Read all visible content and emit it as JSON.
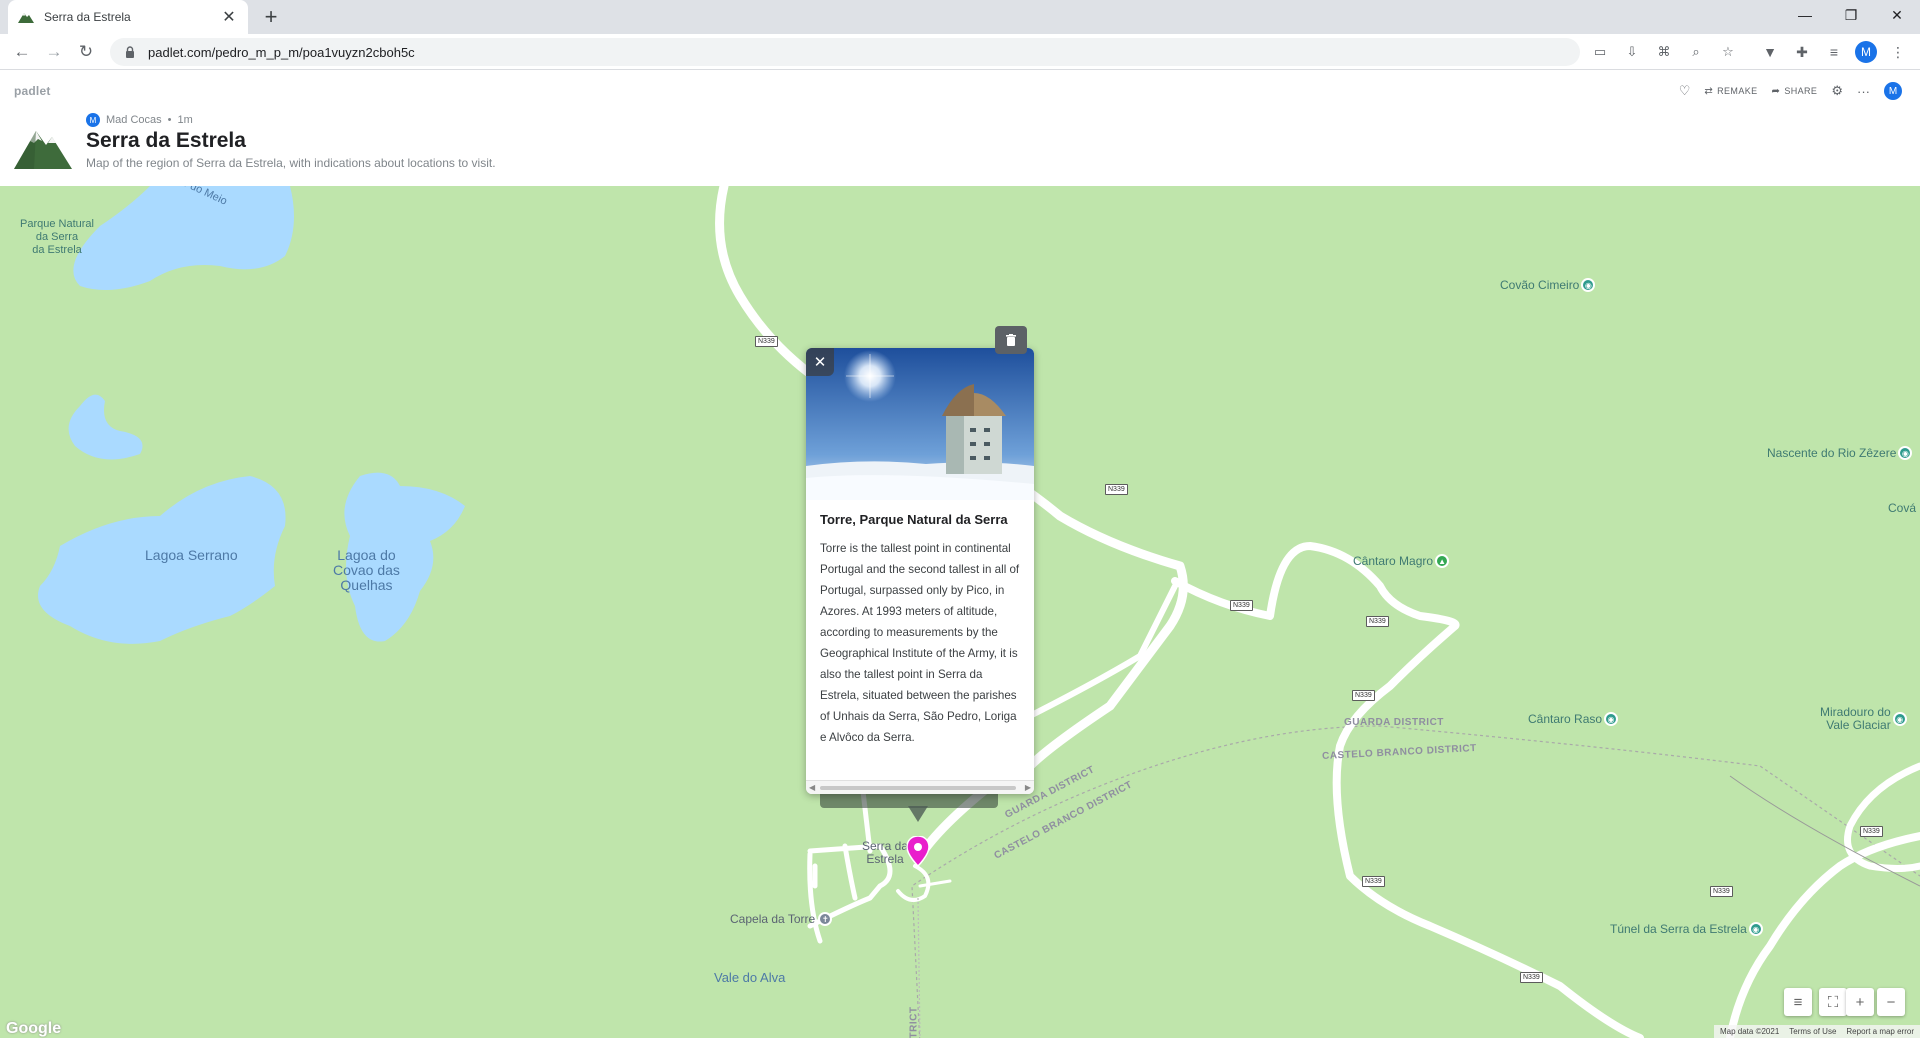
{
  "browser": {
    "tab_title": "Serra da Estrela",
    "url": "padlet.com/pedro_m_p_m/poa1vuyzn2cboh5c",
    "profile_initial": "M"
  },
  "padlet": {
    "brand": "padlet",
    "actions": {
      "remake": "REMAKE",
      "share": "SHARE"
    },
    "user_initial": "M",
    "author": "Mad Cocas",
    "age": "1m",
    "title": "Serra da Estrela",
    "description": "Map of the region of Serra da Estrela, with indications about locations to visit."
  },
  "map": {
    "labels": {
      "parque_natural": "Parque Natural\nda Serra\nda Estrela",
      "lagoa_serrano": "Lagoa Serrano",
      "lagoa_covao": "Lagoa do\nCovao das\nQuelhas",
      "meio_partial": "o do Meio",
      "covao_cimeiro": "Covão Cimeiro",
      "nascente": "Nascente do Rio Zêzere",
      "cova_partial": "Cová",
      "cantaro_magro": "Cântaro Magro",
      "cantaro_raso": "Cântaro Raso",
      "miradouro": "Miradouro do\nVale Glaciar",
      "guarda_district": "GUARDA DISTRICT",
      "castelo_branco_district": "CASTELO BRANCO DISTRICT",
      "serra_estrela": "Serra da\nEstrela",
      "capela_torre": "Capela da Torre",
      "vale_alva": "Vale do Alva",
      "tunel": "Túnel da Serra da Estrela",
      "trict_partial": "TRICT"
    },
    "road": "N339",
    "google": "Google",
    "attribution": [
      "Map data ©2021",
      "Terms of Use",
      "Report a map error"
    ]
  },
  "post": {
    "title": "Torre, Parque Natural da Serra",
    "body": "Torre is the tallest point in continental Portugal and the second tallest in all of Portugal, surpassed only by Pico, in Azores. At 1993 meters of altitude, according to measurements by the Geographical Institute of the Army, it is also the tallest point in Serra da Estrela, situated between the parishes of Unhais da Serra, São Pedro, Loriga e Alvôco da Serra."
  },
  "colors": {
    "map_land": "#bfe5ab",
    "water": "#aadaff",
    "marker": "#e91ecc",
    "poi": "#2e9b8d"
  }
}
